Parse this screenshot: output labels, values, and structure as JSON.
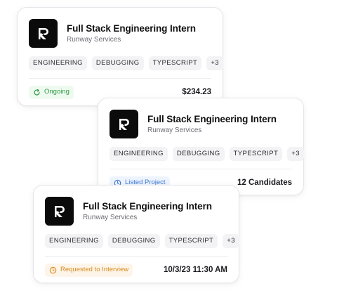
{
  "cards": [
    {
      "logo_icon": "runway-logo-icon",
      "title": "Full Stack Engineering Intern",
      "company": "Runway Services",
      "tags": [
        "ENGINEERING",
        "DEBUGGING",
        "TYPESCRIPT",
        "+3"
      ],
      "status": {
        "label": "Ongoing",
        "icon": "refresh-icon",
        "color": "#2f9a44"
      },
      "meta": "$234.23"
    },
    {
      "logo_icon": "runway-logo-icon",
      "title": "Full Stack Engineering Intern",
      "company": "Runway Services",
      "tags": [
        "ENGINEERING",
        "DEBUGGING",
        "TYPESCRIPT",
        "+3"
      ],
      "status": {
        "label": "Listed Project",
        "icon": "clock-icon",
        "color": "#3a78d6"
      },
      "meta": "12 Candidates"
    },
    {
      "logo_icon": "runway-logo-icon",
      "title": "Full Stack Engineering Intern",
      "company": "Runway Services",
      "tags": [
        "ENGINEERING",
        "DEBUGGING",
        "TYPESCRIPT",
        "+3"
      ],
      "status": {
        "label": "Requested to Interview",
        "icon": "clock-icon",
        "color": "#d98a1c"
      },
      "meta": "10/3/23 11:30 AM"
    }
  ]
}
